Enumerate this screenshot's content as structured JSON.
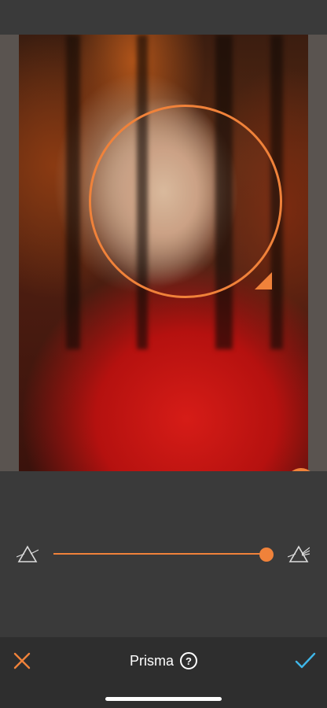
{
  "effect": {
    "name": "Prisma",
    "help_symbol": "?",
    "intensity_fraction": 1.0
  },
  "colors": {
    "accent": "#f0823a",
    "background": "#3a3a3a",
    "bottom_bar": "#2e2e2e",
    "confirm": "#3fb6e8"
  },
  "icons": {
    "cancel": "close-icon",
    "confirm": "checkmark-icon",
    "help": "question-circle-icon",
    "compare": "split-compare-icon",
    "slider_min": "prism-icon",
    "slider_max": "prism-icon"
  }
}
